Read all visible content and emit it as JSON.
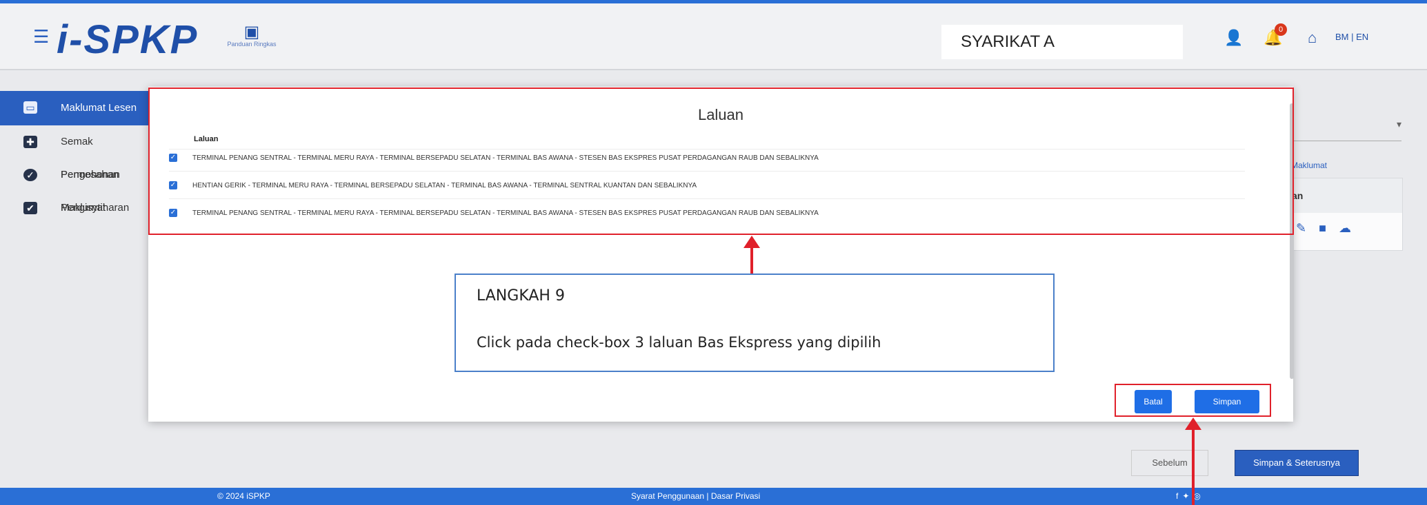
{
  "header": {
    "logo_text": "i-SPKP",
    "guide_label": "Panduan Ringkas",
    "company_name": "SYARIKAT A",
    "notification_count": "0",
    "language_switch": "BM | EN"
  },
  "sidebar": {
    "items": [
      {
        "label": "Maklumat Lesen"
      },
      {
        "label": "Semak Permohonan"
      },
      {
        "label": "Pengesahan Maklumat"
      },
      {
        "label": "Pengisytiharan"
      }
    ]
  },
  "right_panel": {
    "hint": "Maklumat",
    "card_header": "an"
  },
  "modal": {
    "title": "Laluan",
    "column_header": "Laluan",
    "routes": [
      {
        "label": "TERMINAL PENANG SENTRAL - TERMINAL MERU RAYA - TERMINAL BERSEPADU SELATAN - TERMINAL BAS AWANA - STESEN BAS EKSPRES PUSAT PERDAGANGAN RAUB DAN SEBALIKNYA",
        "checked": true
      },
      {
        "label": "HENTIAN GERIK - TERMINAL MERU RAYA - TERMINAL BERSEPADU SELATAN - TERMINAL BAS AWANA - TERMINAL SENTRAL KUANTAN DAN SEBALIKNYA",
        "checked": true
      },
      {
        "label": "TERMINAL PENANG SENTRAL - TERMINAL MERU RAYA - TERMINAL BERSEPADU SELATAN - TERMINAL BAS AWANA - STESEN BAS EKSPRES PUSAT PERDAGANGAN RAUB DAN SEBALIKNYA",
        "checked": true
      }
    ],
    "cancel_label": "Batal",
    "save_label": "Simpan"
  },
  "footer_actions": {
    "previous_label": "Sebelum",
    "next_label": "Simpan & Seterusnya"
  },
  "footer": {
    "copyright": "© 2024 iSPKP",
    "links": "Syarat Penggunaan | Dasar Privasi"
  },
  "callout": {
    "heading": "LANGKAH 9",
    "text": "Click pada check-box 3 laluan Bas Ekspress yang dipilih"
  },
  "colors": {
    "primary": "#2a5fbf",
    "button_blue": "#1f6ee6",
    "highlight_red": "#e0202a",
    "callout_border": "#4a7fc9"
  }
}
